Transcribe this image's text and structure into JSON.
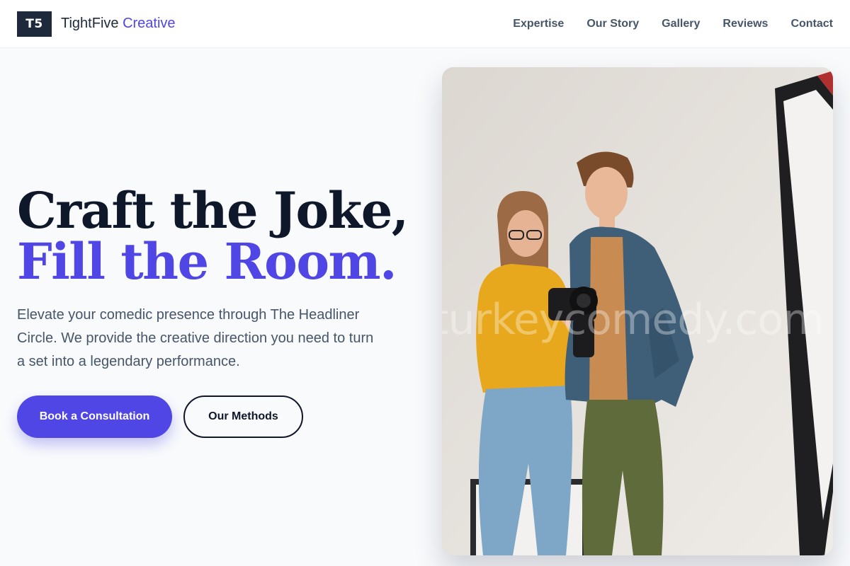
{
  "header": {
    "logo_text": "T5",
    "brand_name": "TightFive",
    "brand_accent": "Creative",
    "nav": [
      {
        "label": "Expertise"
      },
      {
        "label": "Our Story"
      },
      {
        "label": "Gallery"
      },
      {
        "label": "Reviews"
      },
      {
        "label": "Contact"
      }
    ]
  },
  "hero": {
    "title_line1": "Craft the Joke,",
    "title_line2": "Fill the Room.",
    "description": "Elevate your comedic presence through The Headliner Circle. We provide the creative direction you need to turn a set into a legendary performance.",
    "primary_button": "Book a Consultation",
    "secondary_button": "Our Methods"
  },
  "photo": {
    "watermark": "turkeycomedy.com"
  },
  "colors": {
    "accent": "#4f46e5",
    "dark": "#0f172a",
    "muted": "#475569",
    "background": "#f8fafc"
  }
}
